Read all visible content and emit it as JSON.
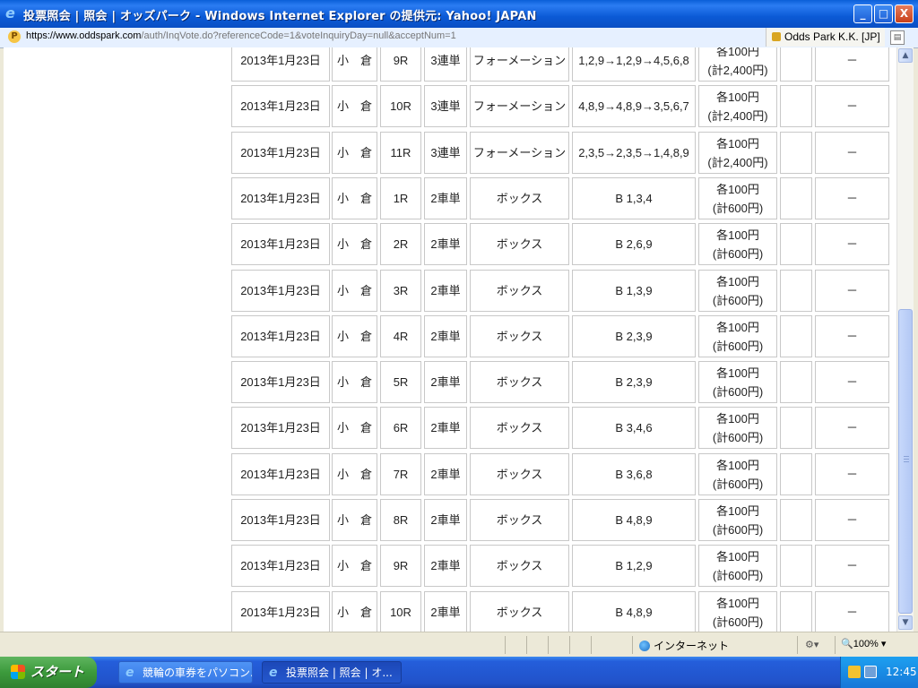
{
  "window": {
    "title": "投票照会 | 照会 | オッズパーク - Windows Internet Explorer の提供元: Yahoo! JAPAN",
    "minimize": "_",
    "maximize": "□",
    "close": "X"
  },
  "address": {
    "scheme": "https://",
    "host": "www.oddspark.com",
    "path": "/auth/InqVote.do?referenceCode=1&voteInquiryDay=null&acceptNum=1",
    "cert": "Odds Park K.K. [JP]"
  },
  "rows": [
    {
      "date": "2013年1月23日",
      "venue": "小　倉",
      "race": "9R",
      "type": "3連単",
      "method": "フォーメーション",
      "numbers": "1,2,9→1,2,9→4,5,6,8",
      "amount1": "各100円",
      "amount2": "(計2,400円)",
      "extra": "",
      "result": "－"
    },
    {
      "date": "2013年1月23日",
      "venue": "小　倉",
      "race": "10R",
      "type": "3連単",
      "method": "フォーメーション",
      "numbers": "4,8,9→4,8,9→3,5,6,7",
      "amount1": "各100円",
      "amount2": "(計2,400円)",
      "extra": "",
      "result": "－"
    },
    {
      "date": "2013年1月23日",
      "venue": "小　倉",
      "race": "11R",
      "type": "3連単",
      "method": "フォーメーション",
      "numbers": "2,3,5→2,3,5→1,4,8,9",
      "amount1": "各100円",
      "amount2": "(計2,400円)",
      "extra": "",
      "result": "－"
    },
    {
      "date": "2013年1月23日",
      "venue": "小　倉",
      "race": "1R",
      "type": "2車単",
      "method": "ボックス",
      "numbers": "B 1,3,4",
      "amount1": "各100円",
      "amount2": "(計600円)",
      "extra": "",
      "result": "－"
    },
    {
      "date": "2013年1月23日",
      "venue": "小　倉",
      "race": "2R",
      "type": "2車単",
      "method": "ボックス",
      "numbers": "B 2,6,9",
      "amount1": "各100円",
      "amount2": "(計600円)",
      "extra": "",
      "result": "－"
    },
    {
      "date": "2013年1月23日",
      "venue": "小　倉",
      "race": "3R",
      "type": "2車単",
      "method": "ボックス",
      "numbers": "B 1,3,9",
      "amount1": "各100円",
      "amount2": "(計600円)",
      "extra": "",
      "result": "－"
    },
    {
      "date": "2013年1月23日",
      "venue": "小　倉",
      "race": "4R",
      "type": "2車単",
      "method": "ボックス",
      "numbers": "B 2,3,9",
      "amount1": "各100円",
      "amount2": "(計600円)",
      "extra": "",
      "result": "－"
    },
    {
      "date": "2013年1月23日",
      "venue": "小　倉",
      "race": "5R",
      "type": "2車単",
      "method": "ボックス",
      "numbers": "B 2,3,9",
      "amount1": "各100円",
      "amount2": "(計600円)",
      "extra": "",
      "result": "－"
    },
    {
      "date": "2013年1月23日",
      "venue": "小　倉",
      "race": "6R",
      "type": "2車単",
      "method": "ボックス",
      "numbers": "B 3,4,6",
      "amount1": "各100円",
      "amount2": "(計600円)",
      "extra": "",
      "result": "－"
    },
    {
      "date": "2013年1月23日",
      "venue": "小　倉",
      "race": "7R",
      "type": "2車単",
      "method": "ボックス",
      "numbers": "B 3,6,8",
      "amount1": "各100円",
      "amount2": "(計600円)",
      "extra": "",
      "result": "－"
    },
    {
      "date": "2013年1月23日",
      "venue": "小　倉",
      "race": "8R",
      "type": "2車単",
      "method": "ボックス",
      "numbers": "B 4,8,9",
      "amount1": "各100円",
      "amount2": "(計600円)",
      "extra": "",
      "result": "－"
    },
    {
      "date": "2013年1月23日",
      "venue": "小　倉",
      "race": "9R",
      "type": "2車単",
      "method": "ボックス",
      "numbers": "B 1,2,9",
      "amount1": "各100円",
      "amount2": "(計600円)",
      "extra": "",
      "result": "－"
    },
    {
      "date": "2013年1月23日",
      "venue": "小　倉",
      "race": "10R",
      "type": "2車単",
      "method": "ボックス",
      "numbers": "B 4,8,9",
      "amount1": "各100円",
      "amount2": "(計600円)",
      "extra": "",
      "result": "－"
    }
  ],
  "status": {
    "zone": "インターネット",
    "zoom": "100%"
  },
  "taskbar": {
    "start": "スタート",
    "tasks": [
      "競輪の車券をパソコン...",
      "投票照会 | 照会 | オ..."
    ],
    "clock": "12:45"
  }
}
